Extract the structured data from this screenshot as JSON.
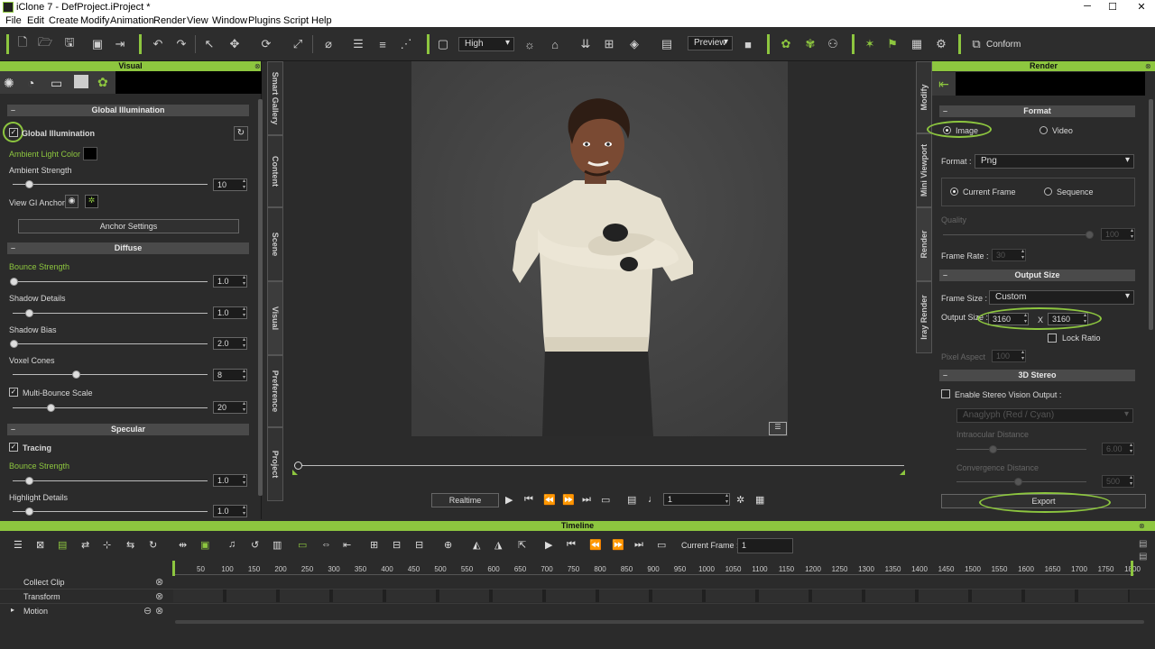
{
  "window": {
    "title": "iClone 7 - DefProject.iProject *",
    "minimize": "─",
    "maximize": "☐",
    "close": "✕"
  },
  "menu": [
    "File",
    "Edit",
    "Create",
    "Modify",
    "Animation",
    "Render",
    "View",
    "Window",
    "Plugins",
    "Script",
    "Help"
  ],
  "toolbar": {
    "quality": "High",
    "preview": "Preview",
    "conform": "Conform"
  },
  "visual_panel": {
    "title": "Visual",
    "gi_section": "Global Illumination",
    "gi_label": "Global Illumination",
    "gi_checked": true,
    "ambient_light_color_label": "Ambient Light Color :",
    "ambient_light_color": "#000000",
    "ambient_strength_label": "Ambient Strength",
    "ambient_strength": "10",
    "view_gi_anchor_label": "View GI Anchor",
    "anchor_settings": "Anchor Settings",
    "diffuse_section": "Diffuse",
    "bounce_strength_label": "Bounce Strength",
    "bounce_strength": "1.0",
    "shadow_details_label": "Shadow Details",
    "shadow_details": "1.0",
    "shadow_bias_label": "Shadow Bias",
    "shadow_bias": "2.0",
    "voxel_cones_label": "Voxel Cones",
    "voxel_cones": "8",
    "multi_bounce_label": "Multi-Bounce Scale",
    "multi_bounce_checked": true,
    "multi_bounce": "20",
    "specular_section": "Specular",
    "tracing_label": "Tracing",
    "tracing_checked": true,
    "spec_bounce_label": "Bounce Strength",
    "spec_bounce": "1.0",
    "highlight_details_label": "Highlight Details",
    "highlight_details": "1.0"
  },
  "left_tabs": [
    "Smart Gallery",
    "Content",
    "Scene",
    "Visual",
    "Preference",
    "Project"
  ],
  "right_tabs": [
    "Modify",
    "Mini Viewport",
    "Render",
    "Iray Render"
  ],
  "viewport": {
    "playback_mode": "Realtime",
    "frame": "1"
  },
  "render_panel": {
    "title": "Render",
    "format_section": "Format",
    "image_label": "Image",
    "video_label": "Video",
    "format_label": "Format :",
    "format_value": "Png",
    "current_frame_label": "Current Frame",
    "sequence_label": "Sequence",
    "quality_label": "Quality",
    "quality_value": "100",
    "frame_rate_label": "Frame Rate :",
    "frame_rate_value": "30",
    "output_size_section": "Output Size",
    "frame_size_label": "Frame Size :",
    "frame_size_value": "Custom",
    "output_size_label": "Output Size :",
    "width": "3160",
    "height": "3160",
    "x_label": "X",
    "lock_ratio_label": "Lock Ratio",
    "pixel_aspect_label": "Pixel Aspect",
    "pixel_aspect_value": "100",
    "stereo_section": "3D Stereo",
    "enable_stereo_label": "Enable Stereo Vision Output :",
    "stereo_mode": "Anaglyph (Red / Cyan)",
    "intraocular_label": "Intraocular Distance",
    "intraocular_value": "6.00",
    "convergence_label": "Convergence Distance",
    "convergence_value": "500",
    "export": "Export"
  },
  "timeline": {
    "title": "Timeline",
    "current_frame_label": "Current Frame :",
    "current_frame": "1",
    "ticks": [
      "50",
      "100",
      "150",
      "200",
      "250",
      "300",
      "350",
      "400",
      "450",
      "500",
      "550",
      "600",
      "650",
      "700",
      "750",
      "800",
      "850",
      "900",
      "950",
      "1000",
      "1050",
      "1100",
      "1150",
      "1200",
      "1250",
      "1300",
      "1350",
      "1400",
      "1450",
      "1500",
      "1550",
      "1600",
      "1650",
      "1700",
      "1750",
      "1800"
    ],
    "tracks": [
      "Collect Clip",
      "Transform",
      "Motion"
    ]
  },
  "colors": {
    "accent": "#8dc63f",
    "panel_bg": "#2b2b2b"
  }
}
